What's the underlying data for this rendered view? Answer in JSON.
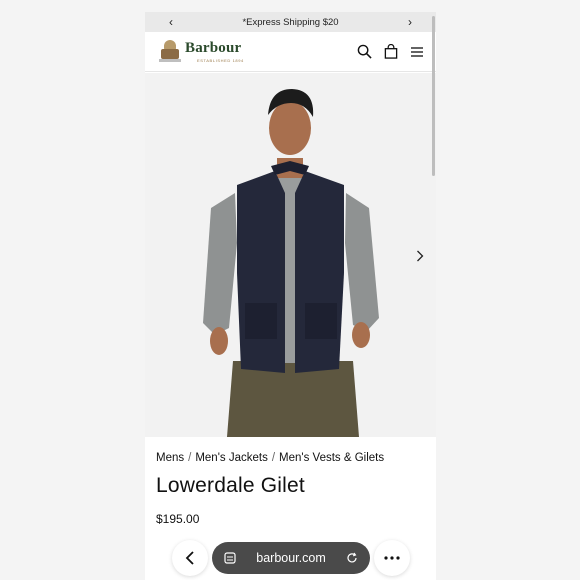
{
  "promo": {
    "text": "*Express Shipping $20"
  },
  "brand": {
    "name": "Barbour",
    "tagline": "ESTABLISHED 1894"
  },
  "breadcrumb": {
    "items": [
      "Mens",
      "Men's Jackets",
      "Men's Vests & Gilets"
    ]
  },
  "product": {
    "title": "Lowerdale Gilet",
    "price": "$195.00"
  },
  "browser": {
    "url": "barbour.com"
  },
  "colors": {
    "brand_green": "#2b4a2c",
    "vest": "#24283a",
    "sweater": "#8f9292",
    "trousers": "#5d5640"
  }
}
